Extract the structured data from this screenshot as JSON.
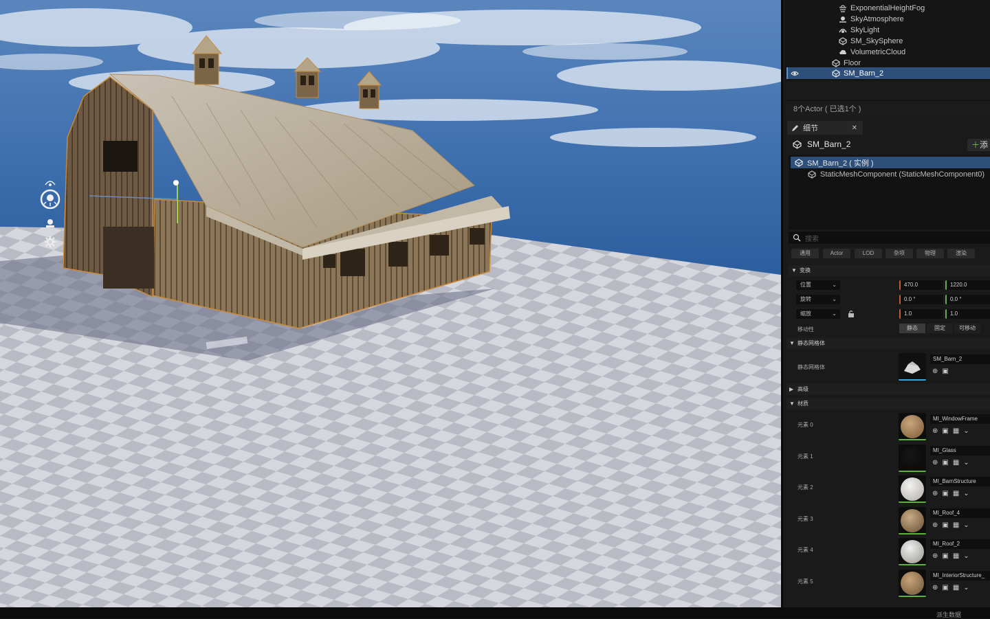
{
  "outliner": {
    "items": [
      {
        "label": "ExponentialHeightFog",
        "icon": "fog-icon"
      },
      {
        "label": "SkyAtmosphere",
        "icon": "sky-atmosphere-icon"
      },
      {
        "label": "SkyLight",
        "icon": "skylight-icon"
      },
      {
        "label": "SM_SkySphere",
        "icon": "static-mesh-icon"
      },
      {
        "label": "VolumetricCloud",
        "icon": "cloud-icon"
      },
      {
        "label": "Floor",
        "icon": "static-mesh-icon"
      },
      {
        "label": "SM_Barn_2",
        "icon": "static-mesh-icon",
        "selected": true
      }
    ],
    "count_label": "8个Actor ( 已选1个 )"
  },
  "details": {
    "tab_label": "细节",
    "actor_name": "SM_Barn_2",
    "add_label": "添",
    "components": {
      "root": "SM_Barn_2 ( 实例 )",
      "child": "StaticMeshComponent (StaticMeshComponent0)"
    },
    "search_placeholder": "搜索",
    "filters": [
      "通用",
      "Actor",
      "LOD",
      "杂项",
      "物理",
      "渲染"
    ],
    "transform": {
      "section": "变换",
      "location_label": "位置",
      "rotation_label": "旋转",
      "scale_label": "缩放",
      "location": [
        "470.0",
        "1220.0"
      ],
      "rotation": [
        "0.0 °",
        "0.0 °"
      ],
      "scale": [
        "1.0",
        "1.0"
      ],
      "mobility_label": "移动性",
      "mobility_options": [
        "静态",
        "固定",
        "可移动"
      ],
      "mobility_selected": "静态"
    },
    "static_mesh": {
      "section": "静态网格体",
      "label": "静态网格体",
      "value": "SM_Barn_2"
    },
    "advanced_section": "高级",
    "materials": {
      "section": "材质",
      "elements": [
        {
          "label": "元素 0",
          "value": "MI_WindowFrame"
        },
        {
          "label": "元素 1",
          "value": "MI_Glass"
        },
        {
          "label": "元素 2",
          "value": "MI_BarnStructure"
        },
        {
          "label": "元素 3",
          "value": "MI_Roof_4"
        },
        {
          "label": "元素 4",
          "value": "MI_Roof_2"
        },
        {
          "label": "元素 5",
          "value": "MI_InteriorStructure_"
        }
      ]
    }
  },
  "statusbar": {
    "text": "派生数据"
  },
  "colors": {
    "selection": "#2d4f7a",
    "accent_green": "#6fbf4f",
    "axis_x": "#c45c2c",
    "axis_y": "#6aa84f"
  }
}
